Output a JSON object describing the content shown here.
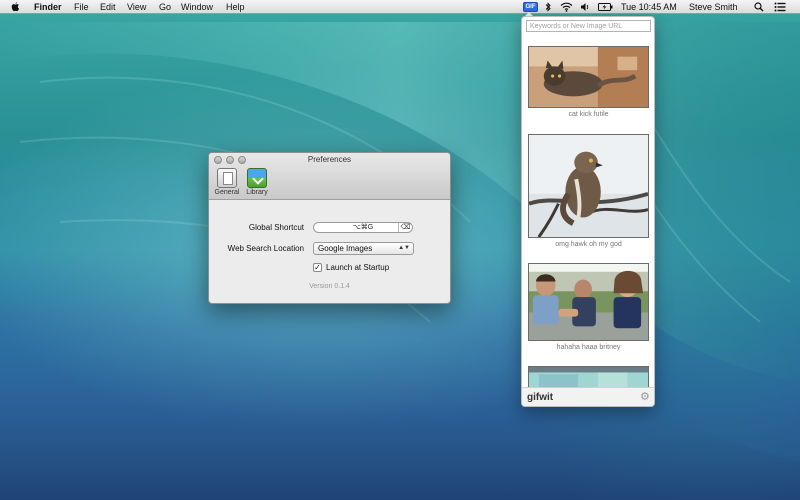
{
  "menubar": {
    "app_name": "Finder",
    "menus": [
      "File",
      "Edit",
      "View",
      "Go",
      "Window",
      "Help"
    ],
    "status": {
      "gif_badge": "GIF",
      "clock": "Tue 10:45 AM",
      "user": "Steve Smith",
      "icons": [
        "bluetooth-icon",
        "wifi-icon",
        "volume-icon",
        "battery-icon",
        "spotlight-icon",
        "notifications-icon"
      ]
    }
  },
  "preferences": {
    "title": "Preferences",
    "tabs": [
      {
        "label": "General",
        "icon": "general-icon"
      },
      {
        "label": "Library",
        "icon": "library-icon"
      }
    ],
    "shortcut_label": "Global Shortcut",
    "shortcut_value": "⌥⌘G",
    "search_location_label": "Web Search Location",
    "search_location_value": "Google Images",
    "launch_label": "Launch at Startup",
    "launch_checked": true,
    "version": "Version 0.1.4"
  },
  "popover": {
    "search_placeholder": "Keywords or New Image URL",
    "gifs": [
      {
        "caption": "cat kick futile"
      },
      {
        "caption": "omg hawk oh my god"
      },
      {
        "caption": "hahaha haaa britney"
      }
    ],
    "brand": "gifwit"
  },
  "colors": {
    "accent_blue": "#2e6fe0",
    "wallpaper_teal": "#2a8f96",
    "wallpaper_blue": "#24497f"
  }
}
